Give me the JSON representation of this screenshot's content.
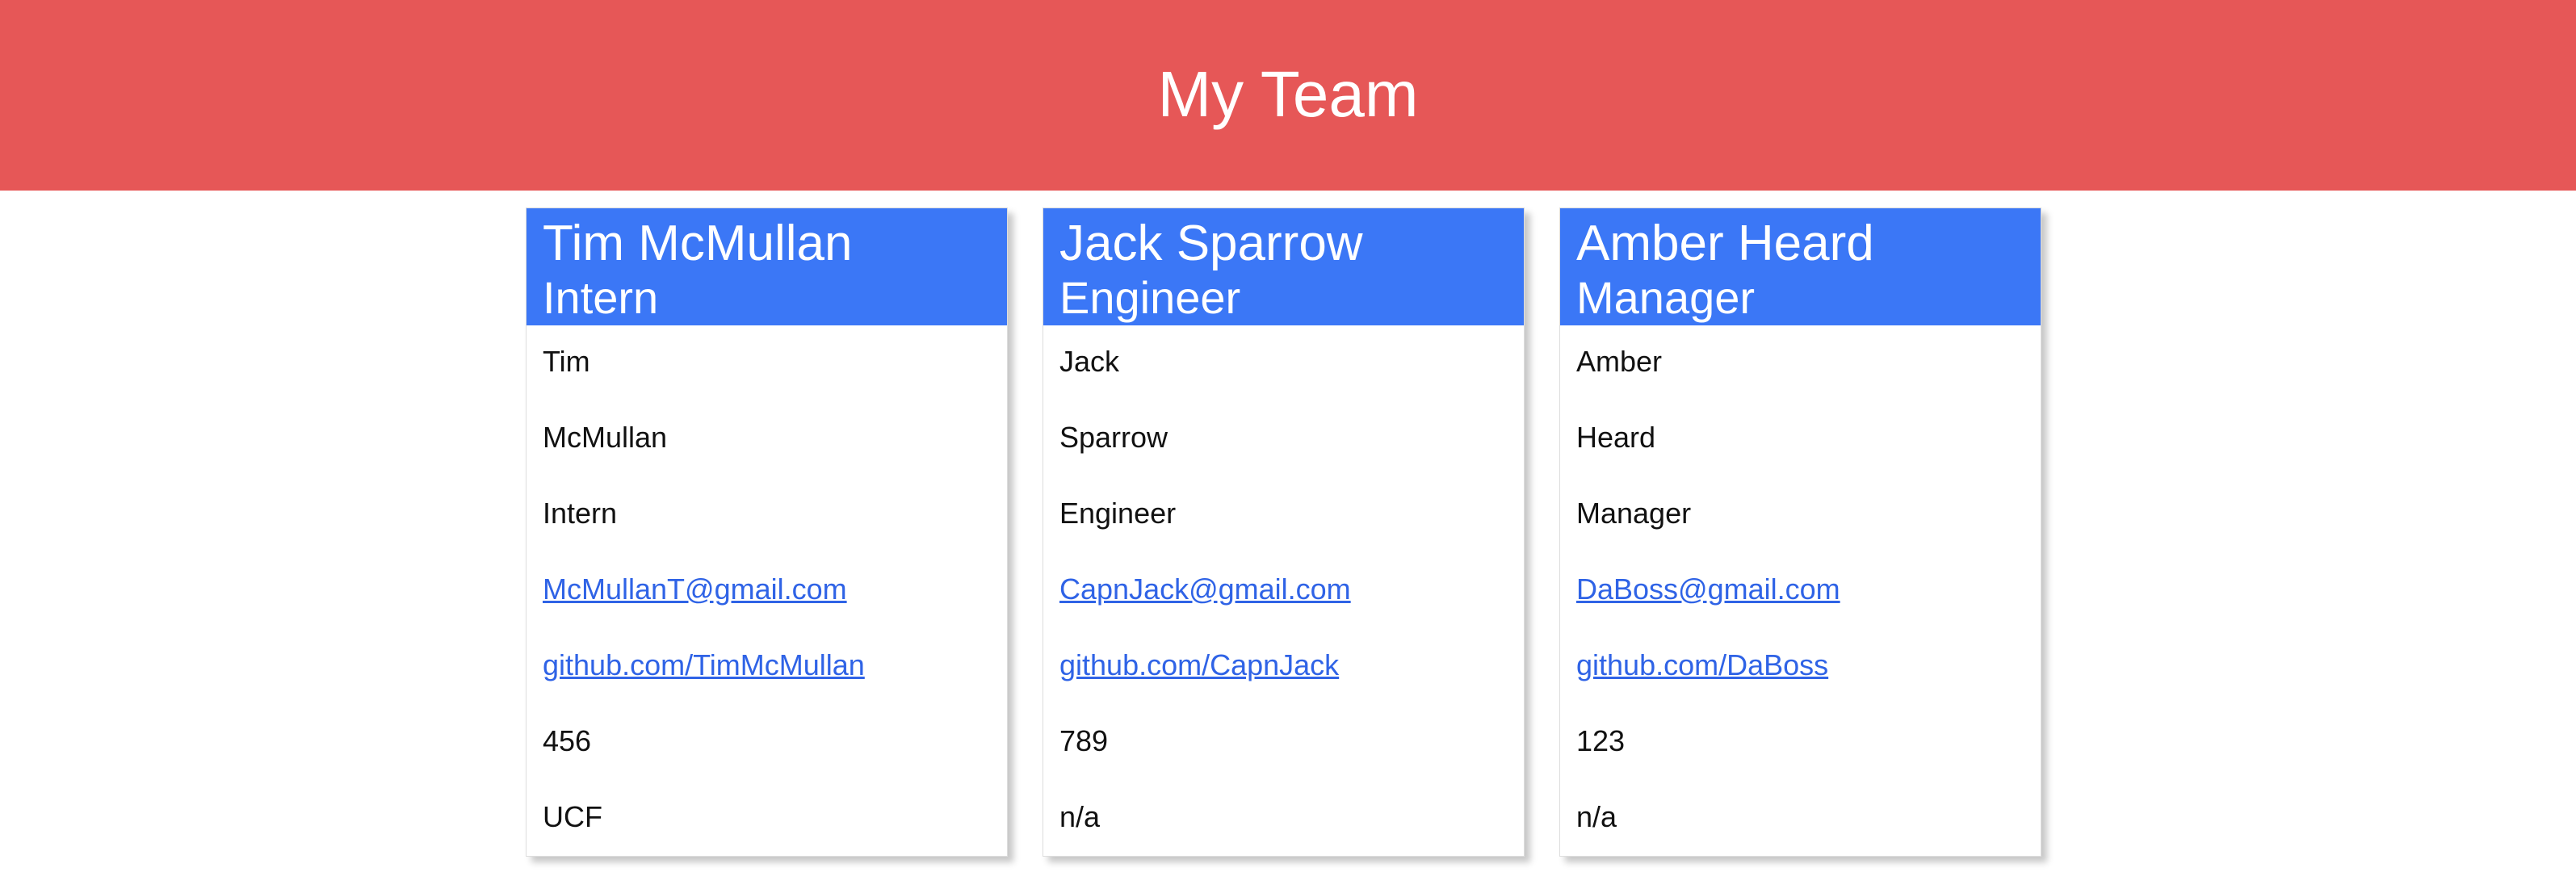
{
  "header": {
    "title": "My Team"
  },
  "colors": {
    "header_bg": "#e65757",
    "card_header_bg": "#3b77f6",
    "link": "#2f63e6"
  },
  "cards": [
    {
      "name": "Tim McMullan",
      "role": "Intern",
      "first_name": "Tim",
      "last_name": "McMullan",
      "title": "Intern",
      "email": "McMullanT@gmail.com",
      "github": "github.com/TimMcMullan",
      "id": "456",
      "extra": "UCF"
    },
    {
      "name": "Jack Sparrow",
      "role": "Engineer",
      "first_name": "Jack",
      "last_name": "Sparrow",
      "title": "Engineer",
      "email": "CapnJack@gmail.com",
      "github": "github.com/CapnJack",
      "id": "789",
      "extra": "n/a"
    },
    {
      "name": "Amber Heard",
      "role": "Manager",
      "first_name": "Amber",
      "last_name": "Heard",
      "title": "Manager",
      "email": "DaBoss@gmail.com",
      "github": "github.com/DaBoss",
      "id": "123",
      "extra": "n/a"
    }
  ]
}
